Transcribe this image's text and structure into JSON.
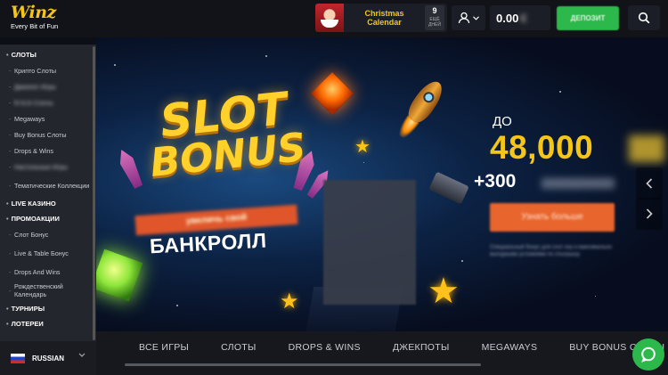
{
  "header": {
    "logo_text": "Winz",
    "logo_tagline": "Every Bit of Fun",
    "christmas_calendar": {
      "title_line1": "Christmas",
      "title_line2": "Calendar",
      "days_number": "9",
      "days_label": "ЕЩЁ ДНЕЙ"
    },
    "balance": "0.00",
    "deposit_label": "ДЕПОЗИТ"
  },
  "sidebar": {
    "sections": [
      {
        "label": "СЛОТЫ",
        "items": [
          "Крипто Слоты",
          "Джекпот Игры",
          "R.N.G Слоты",
          "Megaways",
          "Buy Bonus Слоты",
          "Drops & Wins",
          "Настольные Игры",
          "Тематические Коллекции"
        ]
      },
      {
        "label": "LIVE КАЗИНО",
        "items": []
      },
      {
        "label": "ПРОМОАКЦИИ",
        "items": [
          "Слот Бонус",
          "Live & Table Бонус",
          "Drops And Wins",
          "Рождественский Календарь"
        ]
      },
      {
        "label": "ТУРНИРЫ",
        "items": []
      },
      {
        "label": "ЛОТЕРЕИ",
        "items": []
      }
    ],
    "language": "RUSSIAN"
  },
  "hero": {
    "title_line1": "SLOT",
    "title_line2": "BONUS",
    "ribbon_text": "увеличь свой",
    "bankroll_text": "БАНКРОЛЛ",
    "prefix": "ДО",
    "amount": "48,000",
    "plus_text": "+300",
    "plus_suffix": "фриспинов",
    "cta_label": "Узнать больше",
    "terms_text": "Специальный бонус для слот игр и максимально выгодными условиями по отыгрышу"
  },
  "categories": [
    {
      "label": "ВСЕ ИГРЫ"
    },
    {
      "label": "СЛОТЫ"
    },
    {
      "label": "DROPS & WINS"
    },
    {
      "label": "ДЖЕКПОТЫ"
    },
    {
      "label": "MEGAWAYS"
    },
    {
      "label": "BUY BONUS СЛОТЫ"
    }
  ],
  "colors": {
    "accent_yellow": "#f5c518",
    "deposit_green": "#2db84b",
    "cta_orange": "#e9652e",
    "sidebar_bg": "#24262d"
  },
  "icons": {
    "user": "user-icon",
    "search": "search-icon",
    "chat": "chat-icon",
    "carousel_prev": "chevron-left-icon",
    "carousel_next": "chevron-right-icon"
  }
}
